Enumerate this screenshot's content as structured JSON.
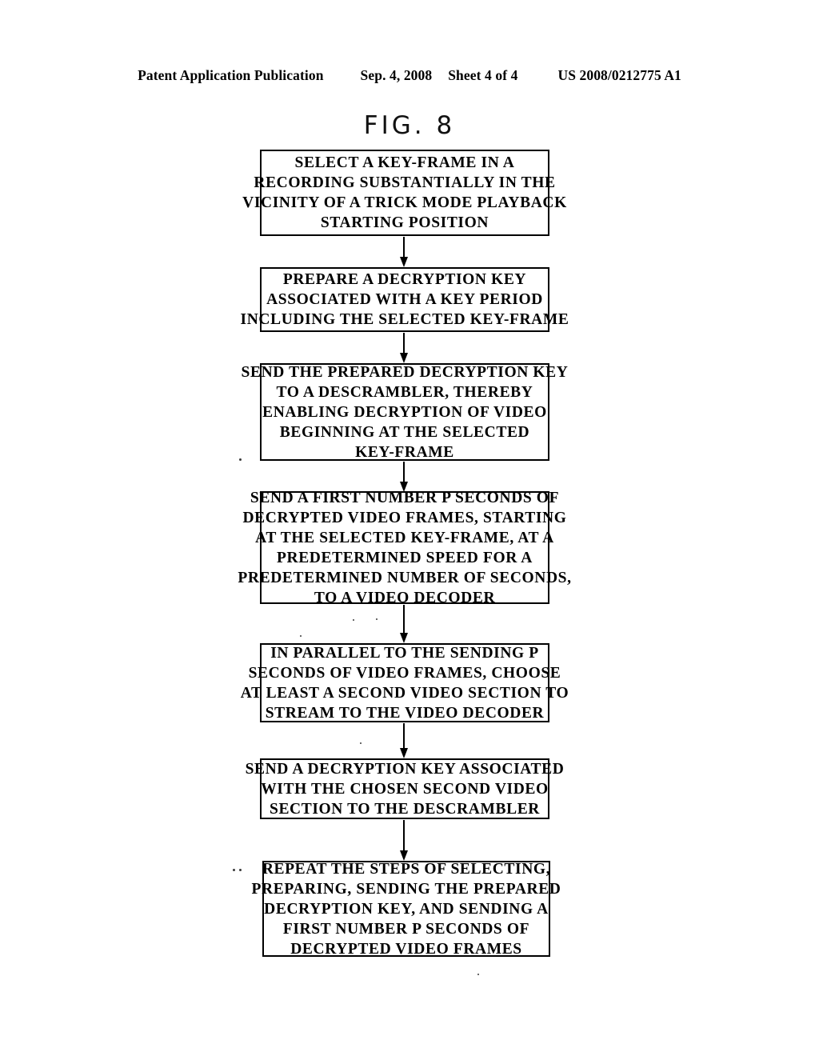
{
  "header": {
    "publication": "Patent Application Publication",
    "date": "Sep. 4, 2008",
    "sheet": "Sheet 4 of 4",
    "document_number": "US 2008/0212775 A1"
  },
  "figure": {
    "title": "FIG. 8",
    "type": "flowchart",
    "orientation": "vertical",
    "connector": "downward-arrow",
    "steps": [
      {
        "id": "step-1",
        "name": "select-key-frame",
        "lines": [
          "SELECT A KEY-FRAME IN A",
          "RECORDING SUBSTANTIALLY IN THE",
          "VICINITY OF A TRICK MODE PLAYBACK",
          "STARTING POSITION"
        ]
      },
      {
        "id": "step-2",
        "name": "prepare-decryption-key",
        "lines": [
          "PREPARE A DECRYPTION KEY",
          "ASSOCIATED WITH A KEY PERIOD",
          "INCLUDING THE SELECTED KEY-FRAME"
        ]
      },
      {
        "id": "step-3",
        "name": "send-key-to-descrambler",
        "lines": [
          "SEND THE PREPARED DECRYPTION KEY",
          "TO A DESCRAMBLER, THEREBY",
          "ENABLING DECRYPTION OF VIDEO",
          "BEGINNING AT THE SELECTED",
          "KEY-FRAME"
        ]
      },
      {
        "id": "step-4",
        "name": "send-p-seconds-of-video",
        "lines": [
          "SEND A FIRST NUMBER P SECONDS OF",
          "DECRYPTED VIDEO FRAMES, STARTING",
          "AT THE SELECTED KEY-FRAME, AT A",
          "PREDETERMINED SPEED FOR A",
          "PREDETERMINED NUMBER OF SECONDS,",
          "TO A VIDEO DECODER"
        ]
      },
      {
        "id": "step-5",
        "name": "choose-second-video-section",
        "lines": [
          "IN PARALLEL TO THE SENDING P",
          "SECONDS OF VIDEO FRAMES, CHOOSE",
          "AT LEAST A SECOND VIDEO SECTION TO",
          "STREAM TO THE VIDEO DECODER"
        ]
      },
      {
        "id": "step-6",
        "name": "send-key-for-second-section",
        "lines": [
          "SEND A DECRYPTION KEY ASSOCIATED",
          "WITH THE CHOSEN SECOND VIDEO",
          "SECTION TO THE DESCRAMBLER"
        ]
      },
      {
        "id": "step-7",
        "name": "repeat-steps",
        "lines": [
          "REPEAT THE STEPS OF SELECTING,",
          "PREPARING, SENDING THE PREPARED",
          "DECRYPTION KEY, AND SENDING A",
          "FIRST NUMBER P SECONDS OF",
          "DECRYPTED VIDEO FRAMES"
        ]
      }
    ]
  },
  "colors": {
    "ink": "#000000",
    "paper": "#ffffff"
  }
}
